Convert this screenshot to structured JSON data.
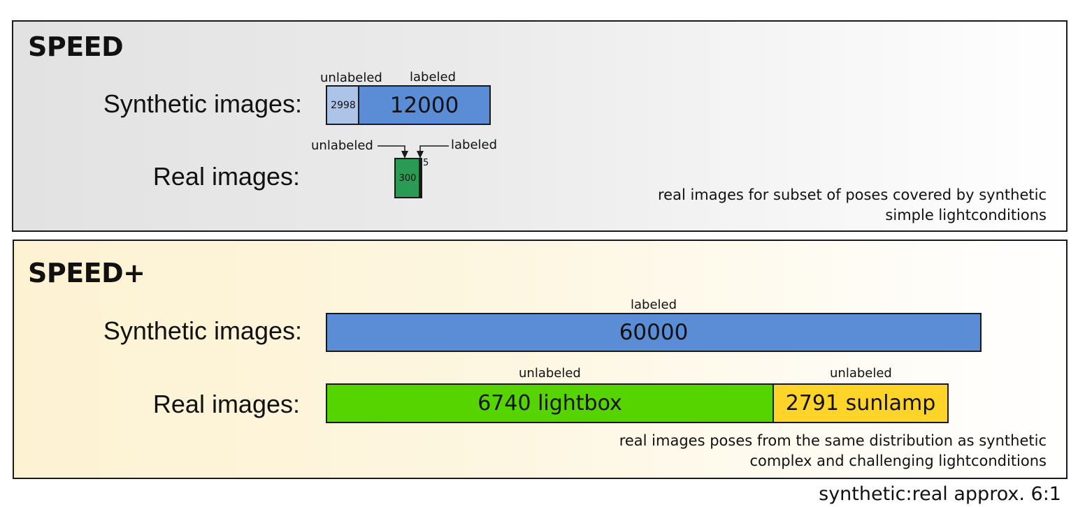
{
  "speed": {
    "title": "SPEED",
    "synthetic_label": "Synthetic images:",
    "real_label": "Real images:",
    "synthetic_unlabeled_caption": "unlabeled",
    "synthetic_labeled_caption": "labeled",
    "synthetic_unlabeled_value": "2998",
    "synthetic_labeled_value": "12000",
    "real_unlabeled_caption": "unlabeled",
    "real_labeled_caption": "labeled",
    "real_unlabeled_value": "300",
    "real_labeled_value": "5",
    "note_line1": "real images for subset of poses covered by synthetic",
    "note_line2": "simple lightconditions"
  },
  "speed_plus": {
    "title": "SPEED+",
    "synthetic_label": "Synthetic images:",
    "real_label": "Real images:",
    "synthetic_caption": "labeled",
    "synthetic_value": "60000",
    "lightbox_caption": "unlabeled",
    "lightbox_value": "6740 lightbox",
    "sunlamp_caption": "unlabeled",
    "sunlamp_value": "2791 sunlamp",
    "note_line1": "real images poses from the same distribution as synthetic",
    "note_line2": "complex and challenging lightconditions"
  },
  "footer": "synthetic:real approx. 6:1",
  "colors": {
    "synthetic_unlabeled": "#adc3e8",
    "synthetic_labeled": "#5b8dd6",
    "real_speed": "#2a9a54",
    "lightbox": "#55d400",
    "sunlamp": "#ffd428",
    "speed_background": "#e2e2e2",
    "speedplus_background": "#fdf2d2"
  }
}
